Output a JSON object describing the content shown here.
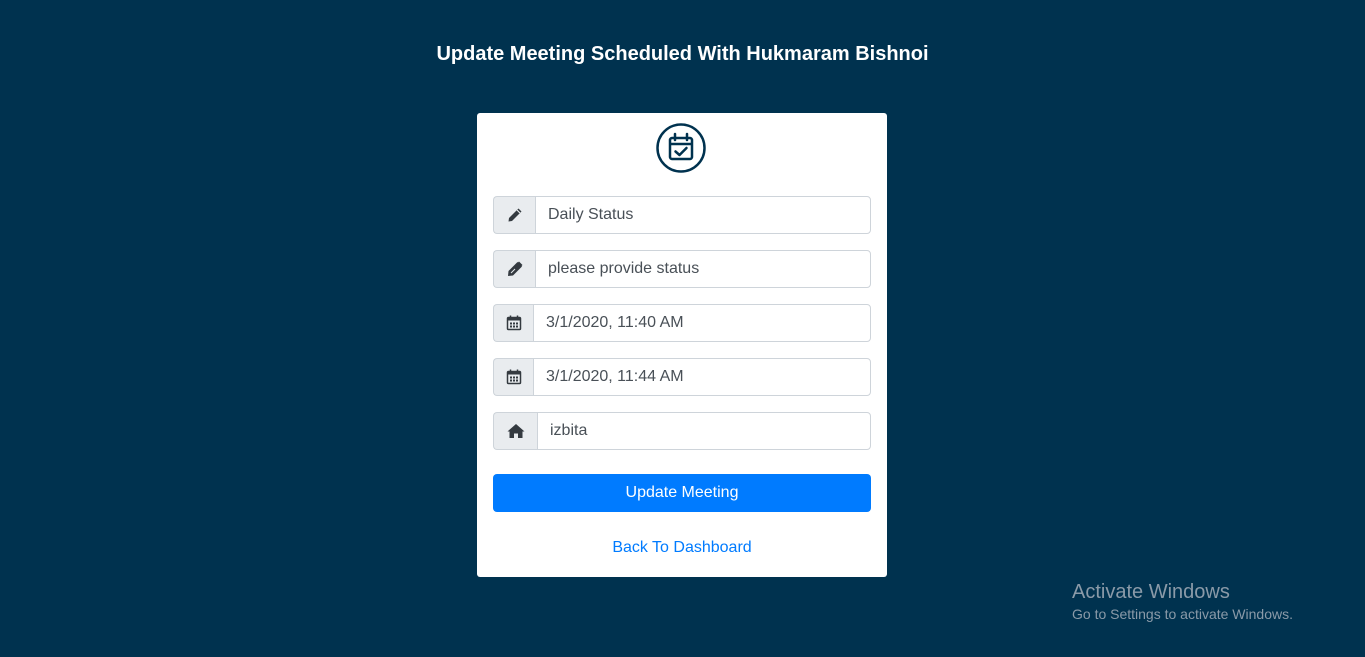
{
  "page": {
    "title": "Update Meeting Scheduled With Hukmaram Bishnoi"
  },
  "form": {
    "header_icon": "calendar-check-icon",
    "fields": [
      {
        "icon": "pencil-icon",
        "value": "Daily Status"
      },
      {
        "icon": "pen-icon",
        "value": "please provide status"
      },
      {
        "icon": "calendar-icon",
        "value": "3/1/2020, 11:40 AM"
      },
      {
        "icon": "calendar-icon",
        "value": "3/1/2020, 11:44 AM"
      },
      {
        "icon": "home-icon",
        "value": "izbita"
      }
    ],
    "submit_label": "Update Meeting",
    "back_link": "Back To Dashboard"
  },
  "watermark": {
    "title": "Activate Windows",
    "subtitle": "Go to Settings to activate Windows."
  },
  "colors": {
    "background": "#00324f",
    "primary": "#007bff",
    "addon_bg": "#e9ecef",
    "icon": "#343a40"
  }
}
